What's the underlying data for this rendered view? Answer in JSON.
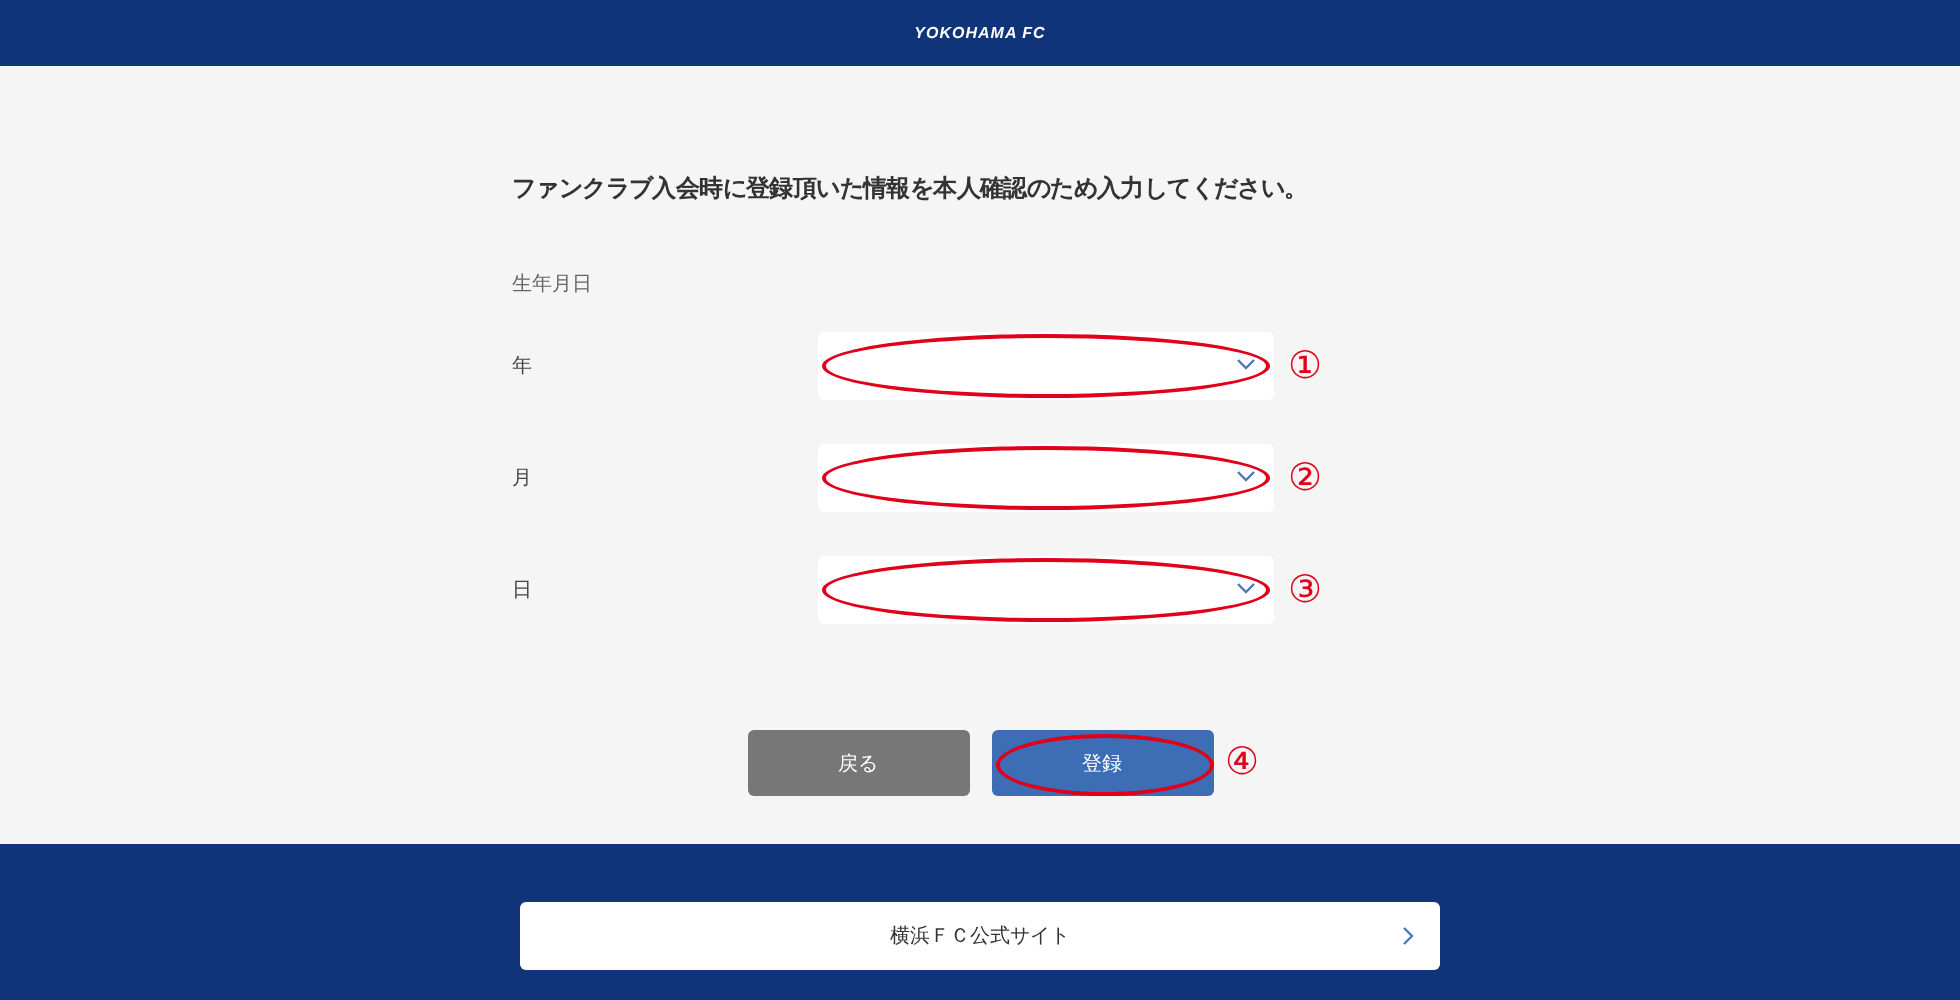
{
  "header": {
    "logo": "YOKOHAMA FC"
  },
  "instruction": "ファンクラブ入会時に登録頂いた情報を本人確認のため入力してください。",
  "section_label": "生年月日",
  "fields": [
    {
      "label": "年",
      "circled": true,
      "marker": "①"
    },
    {
      "label": "月",
      "circled": true,
      "marker": "②"
    },
    {
      "label": "日",
      "circled": true,
      "marker": "③"
    }
  ],
  "buttons": [
    {
      "label": "戻る",
      "kind": "secondary",
      "circled": false
    },
    {
      "label": "登録",
      "kind": "primary",
      "circled": true,
      "marker": "④"
    }
  ],
  "footer": {
    "link": "横浜ＦＣ公式サイト"
  }
}
